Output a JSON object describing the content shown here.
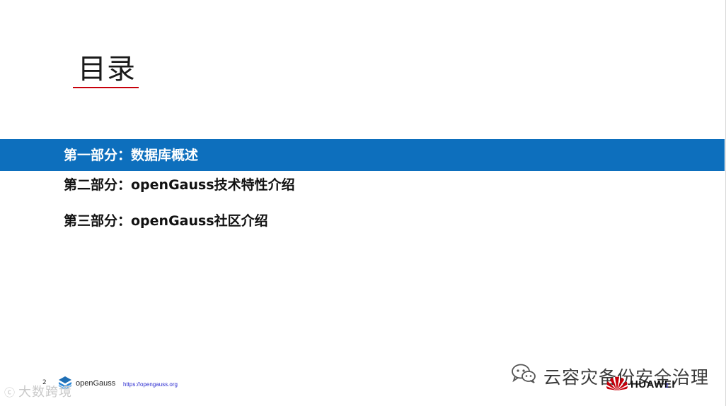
{
  "slide": {
    "title": "目录",
    "accent_color": "#c7000b",
    "band_color": "#0d6fbd"
  },
  "agenda": {
    "items": [
      {
        "label": "第一部分：数据库概述",
        "active": true
      },
      {
        "label": "第二部分：openGauss技术特性介绍",
        "active": false
      },
      {
        "label": "第三部分：openGauss社区介绍",
        "active": false
      }
    ]
  },
  "footer": {
    "page_number": "2",
    "logo_icon": "opengauss-logo-icon",
    "logo_text": "openGauss",
    "url": "https://opengauss.org",
    "brand_text": "HUAWEI",
    "brand_icon": "huawei-logo-icon",
    "brand_page": "2"
  },
  "watermarks": {
    "left_text": "大数跨境",
    "left_icon": "circle-c-icon",
    "right_text": "云容灾备份安全治理",
    "right_icon": "wechat-icon"
  }
}
